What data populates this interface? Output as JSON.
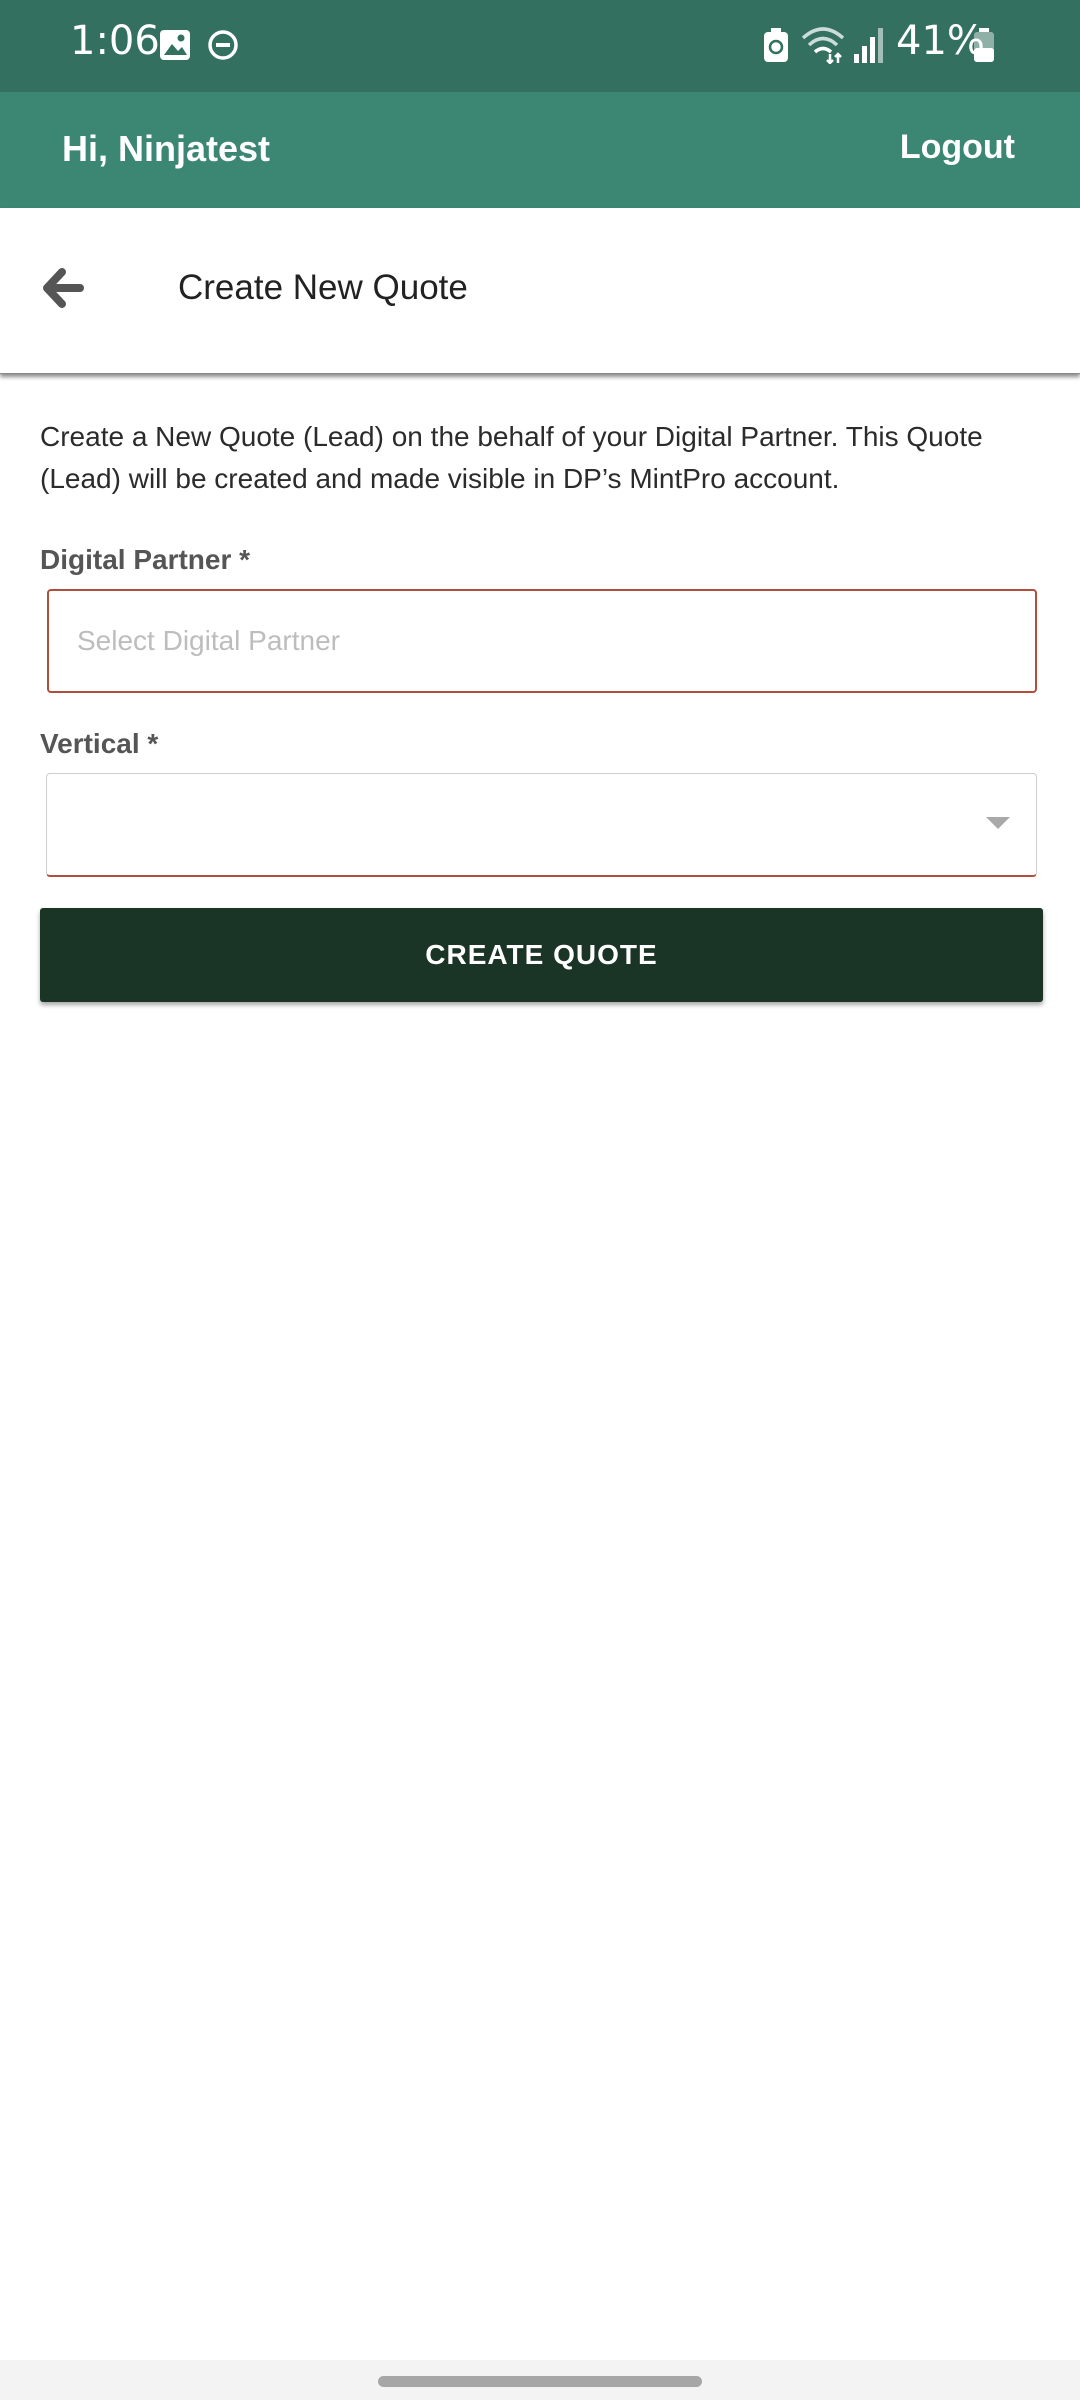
{
  "status_bar": {
    "time": "1:06",
    "battery": "41%",
    "icons": [
      "gallery-icon",
      "do-not-disturb-icon",
      "battery-saver-icon",
      "wifi-icon",
      "signal-icon",
      "battery-icon"
    ]
  },
  "header": {
    "greeting": "Hi, Ninjatest",
    "logout_label": "Logout"
  },
  "title_bar": {
    "back_icon": "arrow-left-icon",
    "title": "Create New Quote"
  },
  "form": {
    "description": "Create a New Quote (Lead) on the behalf of your Digital Partner. This Quote (Lead) will be created and made visible in DP’s MintPro account.",
    "digital_partner": {
      "label": "Digital Partner *",
      "value": "",
      "placeholder": "Select Digital Partner"
    },
    "vertical": {
      "label": "Vertical *",
      "value": ""
    },
    "submit_label": "CREATE QUOTE"
  },
  "colors": {
    "status_bar": "#33705f",
    "header": "#3c8774",
    "button": "#1a3526",
    "error_border": "#b0503c"
  }
}
